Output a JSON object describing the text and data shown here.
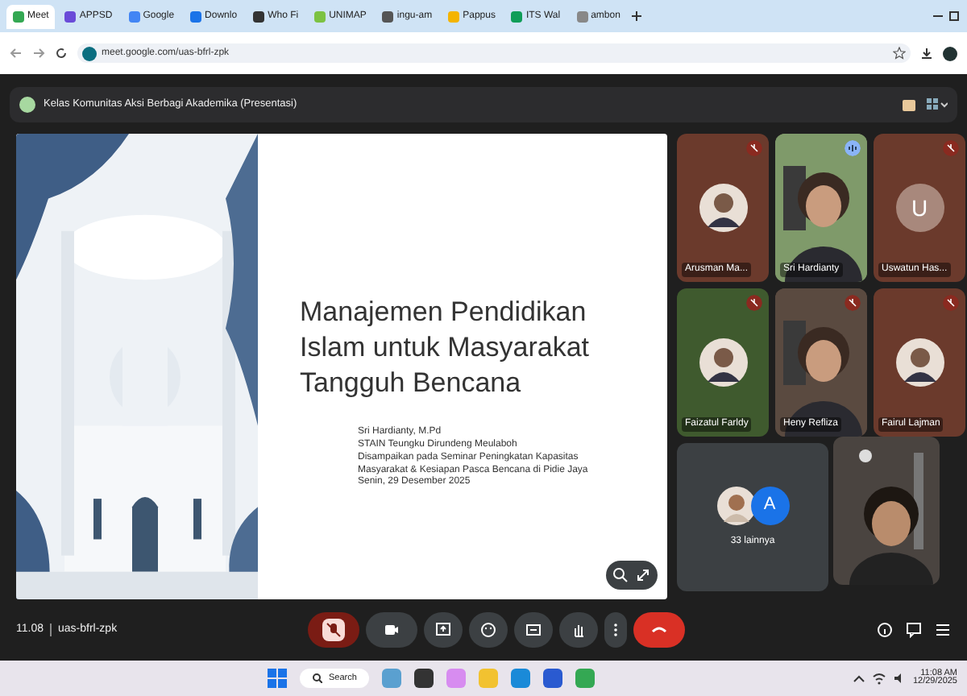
{
  "browser": {
    "tabs": [
      {
        "label": "Meet",
        "selected": true
      },
      {
        "label": "APPSD",
        "selected": false
      },
      {
        "label": "Google",
        "selected": false
      },
      {
        "label": "Downlo",
        "selected": false
      },
      {
        "label": "Who Fi",
        "selected": false
      },
      {
        "label": "UNIMAP",
        "selected": false
      },
      {
        "label": "ingu-am",
        "selected": false
      },
      {
        "label": "Pappus",
        "selected": false
      },
      {
        "label": "ITS Wal",
        "selected": false
      },
      {
        "label": "ambon",
        "selected": false
      }
    ],
    "url": "meet.google.com/uas-bfrl-zpk"
  },
  "meeting": {
    "title": "Kelas Komunitas Aksi Berbagi Akademika (Presentasi)"
  },
  "slide": {
    "title_lines": [
      "Manajemen Pendidikan",
      "Islam untuk Masyarakat",
      "Tangguh Bencana"
    ],
    "credits": [
      "Sri Hardianty, M.Pd",
      "STAIN Teungku Dirundeng Meulaboh",
      "Disampaikan pada Seminar Peningkatan Kapasitas",
      "Masyarakat & Kesiapan Pasca Bencana di Pidie Jaya",
      "Senin, 29 Desember 2025"
    ]
  },
  "participants": [
    {
      "name": "Arusman Ma...",
      "kind": "avatar",
      "color": "#6b3a2c",
      "muted": true
    },
    {
      "name": "Sri Hardianty",
      "kind": "video",
      "color": "#7f9a6a",
      "muted": false
    },
    {
      "name": "Uswatun Has...",
      "kind": "letter",
      "letter": "U",
      "color": "#6b3a2c",
      "muted": true
    },
    {
      "name": "Faizatul Farldy",
      "kind": "avatar",
      "color": "#3f5a2e",
      "muted": true
    },
    {
      "name": "Heny Refliza",
      "kind": "video",
      "color": "#5a4a40",
      "muted": true
    },
    {
      "name": "Fairul Lajman",
      "kind": "avatar",
      "color": "#6b3a2c",
      "muted": true
    }
  ],
  "others": {
    "letter": "A",
    "label": "33 lainnya"
  },
  "controls": {
    "time": "11.08",
    "code": "uas-bfrl-zpk",
    "mic_on": false
  },
  "taskbar": {
    "search": "Search",
    "time": "11:08 AM",
    "date": "12/29/2025"
  }
}
